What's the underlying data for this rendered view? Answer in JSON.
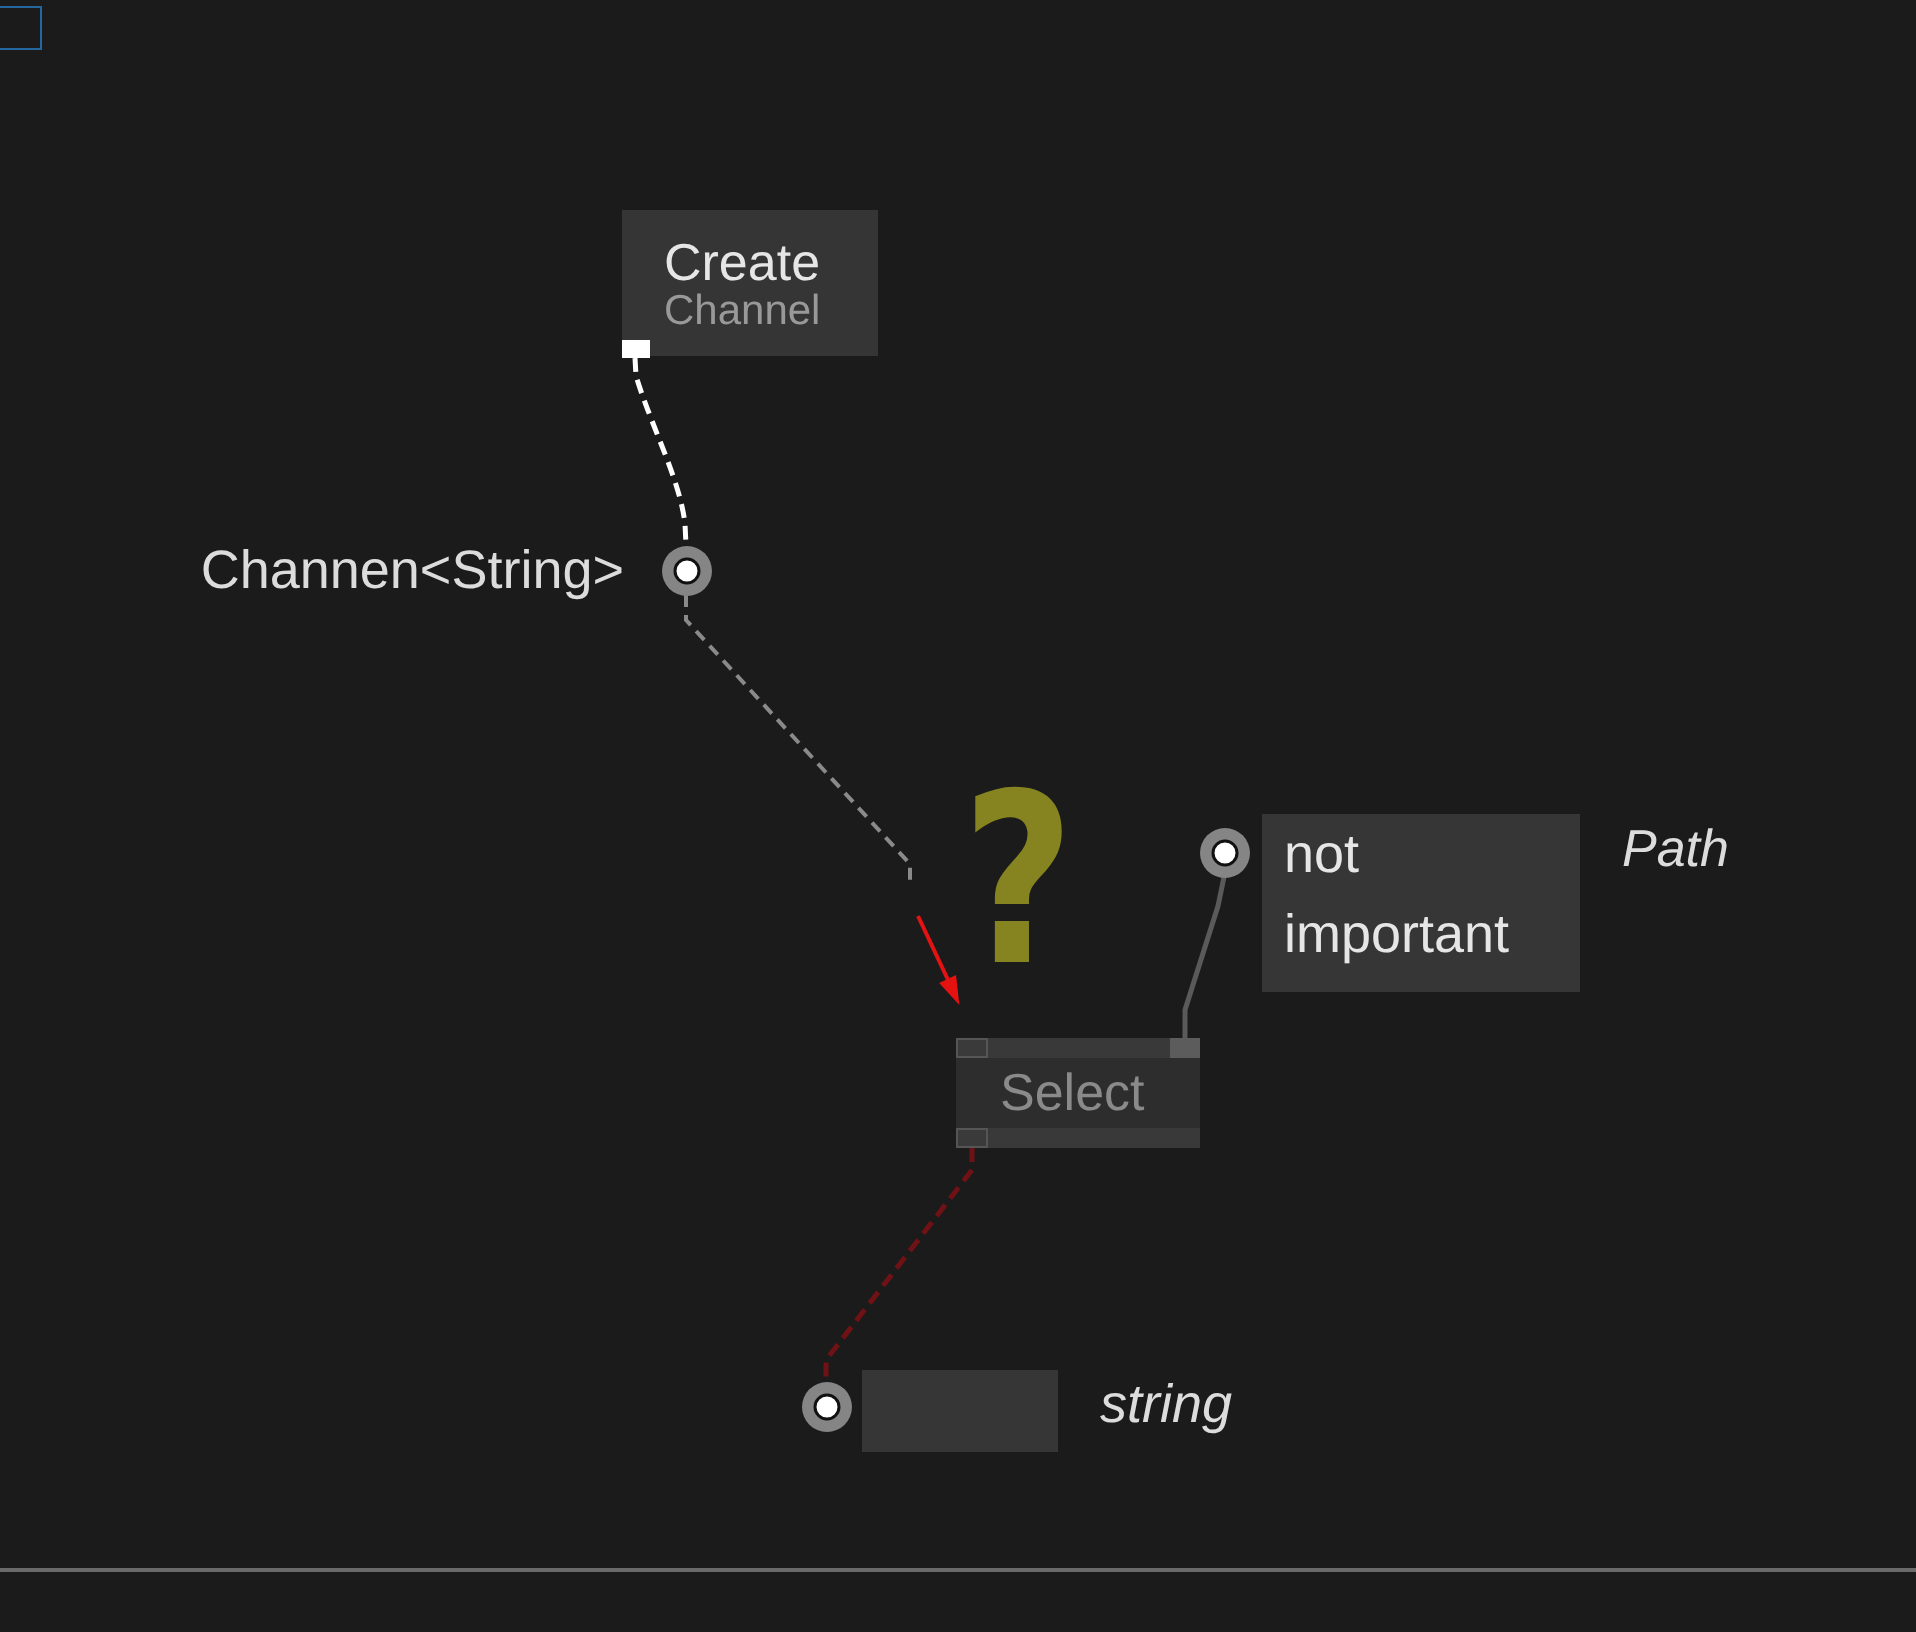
{
  "nodes": [
    {
      "kind": "block",
      "title": "Create",
      "subtitle": "Channel",
      "dimmed": false
    },
    {
      "kind": "pinbar",
      "title": "Select",
      "dimmed": true
    }
  ],
  "output_pin": {
    "label": "Channen<String>"
  },
  "io_boxes": [
    {
      "value": "not important",
      "type_label": "Path"
    },
    {
      "type_label": "string"
    }
  ],
  "links": [
    {
      "color": "#ffffff",
      "dashed": true
    },
    {
      "color": "#8a8a8a",
      "dashed": true
    },
    {
      "color": "#5a5a5a",
      "dashed": false
    },
    {
      "color": "#6e1216",
      "dashed": true
    }
  ],
  "annotation": {
    "mark": "?"
  }
}
